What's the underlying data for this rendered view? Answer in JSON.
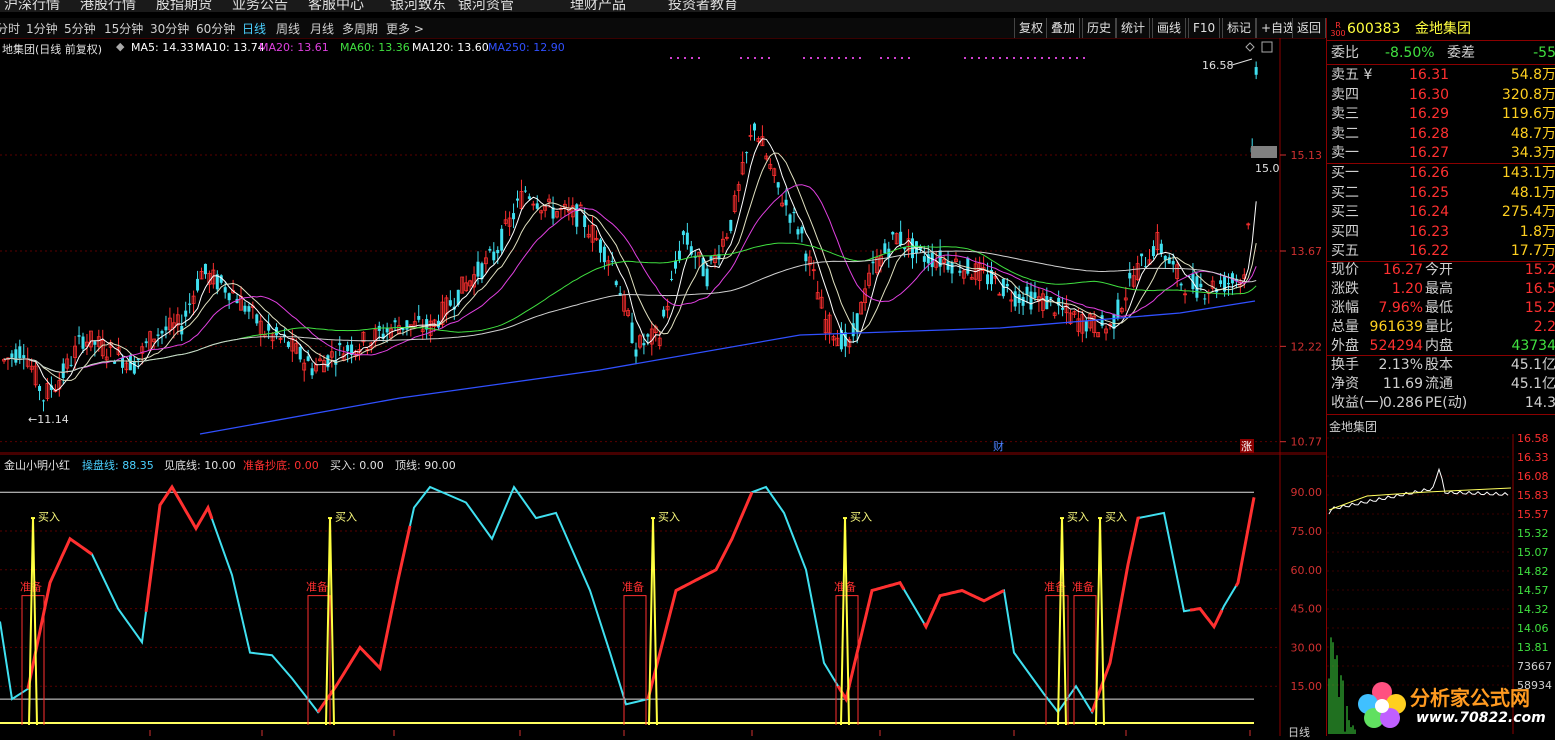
{
  "top_menu": [
    "沪深行情",
    "港股行情",
    "股指期货",
    "业务公告",
    "客服中心",
    "银河致东",
    "银河资管",
    "理财产品",
    "投资者教育"
  ],
  "periods": [
    "分时",
    "1分钟",
    "5分钟",
    "15分钟",
    "30分钟",
    "60分钟",
    "日线",
    "周线",
    "月线",
    "多周期",
    "更多 >"
  ],
  "active_period": "日线",
  "tool_buttons": [
    "复权",
    "叠加",
    "历史",
    "统计",
    "画线",
    "F10",
    "标记",
    "+自选",
    "返回"
  ],
  "chart_title": "地集团(日线 前复权)",
  "ma_legend": [
    {
      "label": "MA5: 14.33",
      "color": "#ffffff"
    },
    {
      "label": "MA10: 13.74",
      "color": "#ffffff"
    },
    {
      "label": "MA20: 13.61",
      "color": "#e040e0"
    },
    {
      "label": "MA60: 13.36",
      "color": "#40e040"
    },
    {
      "label": "MA120: 13.60",
      "color": "#ffffff"
    },
    {
      "label": "MA250: 12.90",
      "color": "#3050ff"
    }
  ],
  "price_axis": [
    "15.13",
    "13.67",
    "12.22",
    "10.77"
  ],
  "price_high_label": "16.58",
  "price_low_label": "11.14",
  "price_cursor_label": "15.0",
  "markers": {
    "cai": "财",
    "zhang": "涨"
  },
  "sub_legend": [
    {
      "label": "金山小明小红",
      "color": "#e0e0e0"
    },
    {
      "label": "操盘线: 88.35",
      "color": "#4ad0ff"
    },
    {
      "label": "见底线: 10.00",
      "color": "#e0e0e0"
    },
    {
      "label": "准备抄底: 0.00",
      "color": "#ff3030"
    },
    {
      "label": "买入: 0.00",
      "color": "#e0e0e0"
    },
    {
      "label": "顶线: 90.00",
      "color": "#e0e0e0"
    }
  ],
  "sub_axis": [
    "90.00",
    "75.00",
    "60.00",
    "45.00",
    "30.00",
    "15.00"
  ],
  "buy_label": "买入",
  "prepare_label": "准备",
  "colors": {
    "up": "#ff3030",
    "down": "#40e0f0",
    "ma5": "#ffffff",
    "ma20": "#e040e0",
    "ma60": "#40e040",
    "ma250": "#3050ff",
    "accent": "#8b0000"
  },
  "stock": {
    "code": "600383",
    "name": "金地集团",
    "badge_top": "R",
    "badge_bottom": "300"
  },
  "weibi": {
    "label": "委比",
    "value": "-8.50%",
    "label2": "委差",
    "value2": "-55"
  },
  "asks": [
    {
      "label": "卖五",
      "price": "16.31",
      "vol": "54.8万"
    },
    {
      "label": "卖四",
      "price": "16.30",
      "vol": "320.8万"
    },
    {
      "label": "卖三",
      "price": "16.29",
      "vol": "119.6万"
    },
    {
      "label": "卖二",
      "price": "16.28",
      "vol": "48.7万"
    },
    {
      "label": "卖一",
      "price": "16.27",
      "vol": "34.3万"
    }
  ],
  "bids": [
    {
      "label": "买一",
      "price": "16.26",
      "vol": "143.1万"
    },
    {
      "label": "买二",
      "price": "16.25",
      "vol": "48.1万"
    },
    {
      "label": "买三",
      "price": "16.24",
      "vol": "275.4万"
    },
    {
      "label": "买四",
      "price": "16.23",
      "vol": "1.8万"
    },
    {
      "label": "买五",
      "price": "16.22",
      "vol": "17.7万"
    }
  ],
  "quote": [
    {
      "l1": "现价",
      "v1": "16.27",
      "l2": "今开",
      "v2": "15.2"
    },
    {
      "l1": "涨跌",
      "v1": "1.20",
      "l2": "最高",
      "v2": "16.5"
    },
    {
      "l1": "涨幅",
      "v1": "7.96%",
      "l2": "最低",
      "v2": "15.2"
    },
    {
      "l1": "总量",
      "v1": "961639",
      "l2": "量比",
      "v2": "2.2"
    },
    {
      "l1": "外盘",
      "v1": "524294",
      "l2": "内盘",
      "v2": "43734"
    }
  ],
  "fund": [
    {
      "l1": "换手",
      "v1": "2.13%",
      "l2": "股本",
      "v2": "45.1亿"
    },
    {
      "l1": "净资",
      "v1": "11.69",
      "l2": "流通",
      "v2": "45.1亿"
    },
    {
      "l1": "收益(一)",
      "v1": "0.286",
      "l2": "PE(动)",
      "v2": "14.3"
    }
  ],
  "mini_title": "金地集团",
  "mini_axis": [
    "16.58",
    "16.33",
    "16.08",
    "15.83",
    "15.57",
    "15.32",
    "15.07",
    "14.82",
    "14.57",
    "14.32",
    "14.06",
    "13.81",
    "73667",
    "58934"
  ],
  "bottom_label": "日线",
  "watermark": {
    "text": "分析家公式网",
    "url": "www.70822.com"
  }
}
